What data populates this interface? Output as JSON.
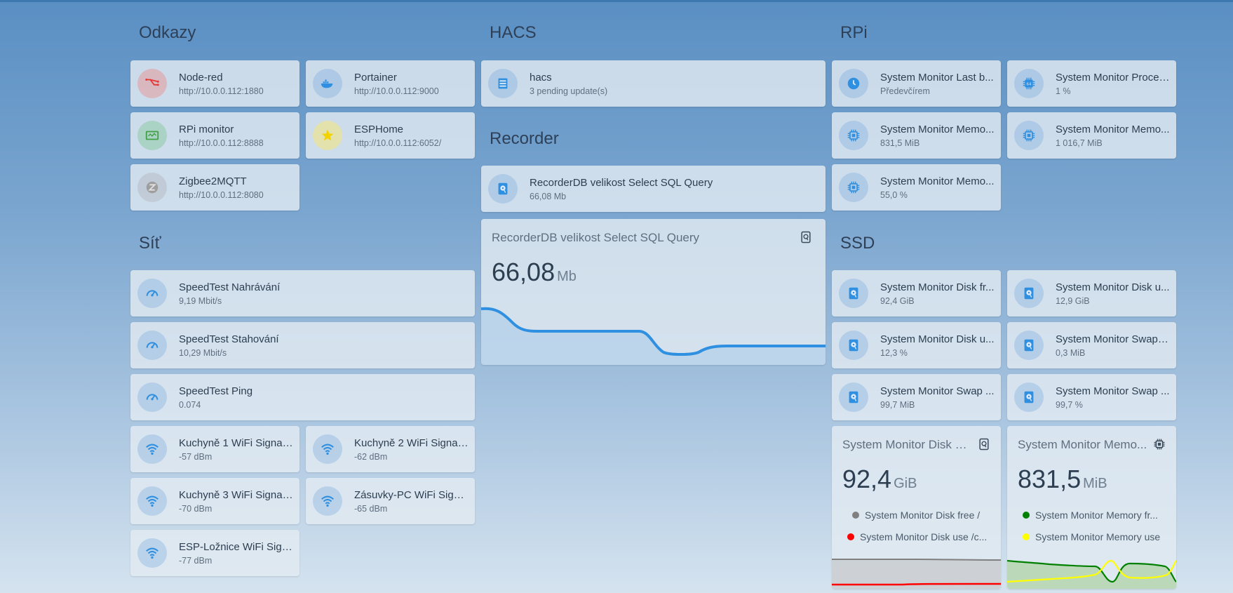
{
  "sections": {
    "odkazy": "Odkazy",
    "hacs": "HACS",
    "rpi": "RPi",
    "recorder": "Recorder",
    "sit": "Síť",
    "ssd": "SSD"
  },
  "odkazy": [
    {
      "name": "Node-red",
      "state": "http://10.0.0.112:1880",
      "icon": "node-red-icon",
      "color": "#e57373"
    },
    {
      "name": "Portainer",
      "state": "http://10.0.0.112:9000",
      "icon": "docker-icon",
      "color": "#2f8fe0"
    },
    {
      "name": "RPi monitor",
      "state": "http://10.0.0.112:8888",
      "icon": "monitor-icon",
      "color": "#43a047"
    },
    {
      "name": "ESPHome",
      "state": "http://10.0.0.112:6052/",
      "icon": "star-icon",
      "color": "#f2d300"
    },
    {
      "name": "Zigbee2MQTT",
      "state": "http://10.0.0.112:8080",
      "icon": "zigbee-icon",
      "color": "#9e9e9e"
    }
  ],
  "hacs": {
    "name": "hacs",
    "state": "3 pending update(s)",
    "icon": "hacs-icon"
  },
  "recorder": {
    "entity": {
      "name": "RecorderDB velikost Select SQL Query",
      "state": "66,08 Mb",
      "icon": "database-icon"
    },
    "sensor": {
      "title": "RecorderDB velikost Select SQL Query",
      "value": "66,08",
      "unit": "Mb",
      "icon": "harddisk-icon"
    }
  },
  "rpi": [
    {
      "name": "System Monitor Last b...",
      "state": "Předevčírem",
      "icon": "clock-icon"
    },
    {
      "name": "System Monitor Proces...",
      "state": "1 %",
      "icon": "cpu-64-icon"
    },
    {
      "name": "System Monitor Memo...",
      "state": "831,5 MiB",
      "icon": "chip-icon"
    },
    {
      "name": "System Monitor Memo...",
      "state": "1 016,7 MiB",
      "icon": "chip-icon"
    },
    {
      "name": "System Monitor Memo...",
      "state": "55,0 %",
      "icon": "chip-icon"
    }
  ],
  "sit": [
    {
      "name": "SpeedTest Nahrávání",
      "state": "9,19 Mbit/s",
      "icon": "speedometer-icon"
    },
    {
      "name": "SpeedTest Stahování",
      "state": "10,29 Mbit/s",
      "icon": "speedometer-icon"
    },
    {
      "name": "SpeedTest Ping",
      "state": "0.074",
      "icon": "speedometer-icon"
    },
    {
      "name": "Kuchyně 1 WiFi Signal S...",
      "state": "-57 dBm",
      "icon": "wifi-icon"
    },
    {
      "name": "Kuchyně 2 WiFi Signal ...",
      "state": "-62 dBm",
      "icon": "wifi-icon"
    },
    {
      "name": "Kuchyně 3 WiFi Signal ...",
      "state": "-70 dBm",
      "icon": "wifi-icon"
    },
    {
      "name": "Zásuvky-PC WiFi Signal...",
      "state": "-65 dBm",
      "icon": "wifi-icon"
    },
    {
      "name": "ESP-Ložnice WiFi Signa...",
      "state": "-77 dBm",
      "icon": "wifi-icon"
    }
  ],
  "ssd": [
    {
      "name": "System Monitor Disk fr...",
      "state": "92,4 GiB",
      "icon": "harddisk-icon"
    },
    {
      "name": "System Monitor Disk u...",
      "state": "12,9 GiB",
      "icon": "harddisk-icon"
    },
    {
      "name": "System Monitor Disk u...",
      "state": "12,3 %",
      "icon": "harddisk-icon"
    },
    {
      "name": "System Monitor Swap f...",
      "state": "0,3 MiB",
      "icon": "harddisk-icon"
    },
    {
      "name": "System Monitor Swap ...",
      "state": "99,7 MiB",
      "icon": "harddisk-icon"
    },
    {
      "name": "System Monitor Swap ...",
      "state": "99,7 %",
      "icon": "harddisk-icon"
    }
  ],
  "ssd_graphs": {
    "disk": {
      "title": "System Monitor Disk fr...",
      "value": "92,4",
      "unit": "GiB",
      "icon": "harddisk-icon",
      "legend": [
        {
          "label": "System Monitor Disk free /",
          "color": "#808080"
        },
        {
          "label": "System Monitor Disk use /c...",
          "color": "#ff0000"
        }
      ]
    },
    "memory": {
      "title": "System Monitor Memo...",
      "value": "831,5",
      "unit": "MiB",
      "icon": "chip-icon",
      "legend": [
        {
          "label": "System Monitor Memory fr...",
          "color": "#008000"
        },
        {
          "label": "System Monitor Memory use",
          "color": "#ffff00"
        }
      ]
    }
  },
  "colors": {
    "accent": "#2f8fe0",
    "icon_bg": "#b8d3ee"
  }
}
